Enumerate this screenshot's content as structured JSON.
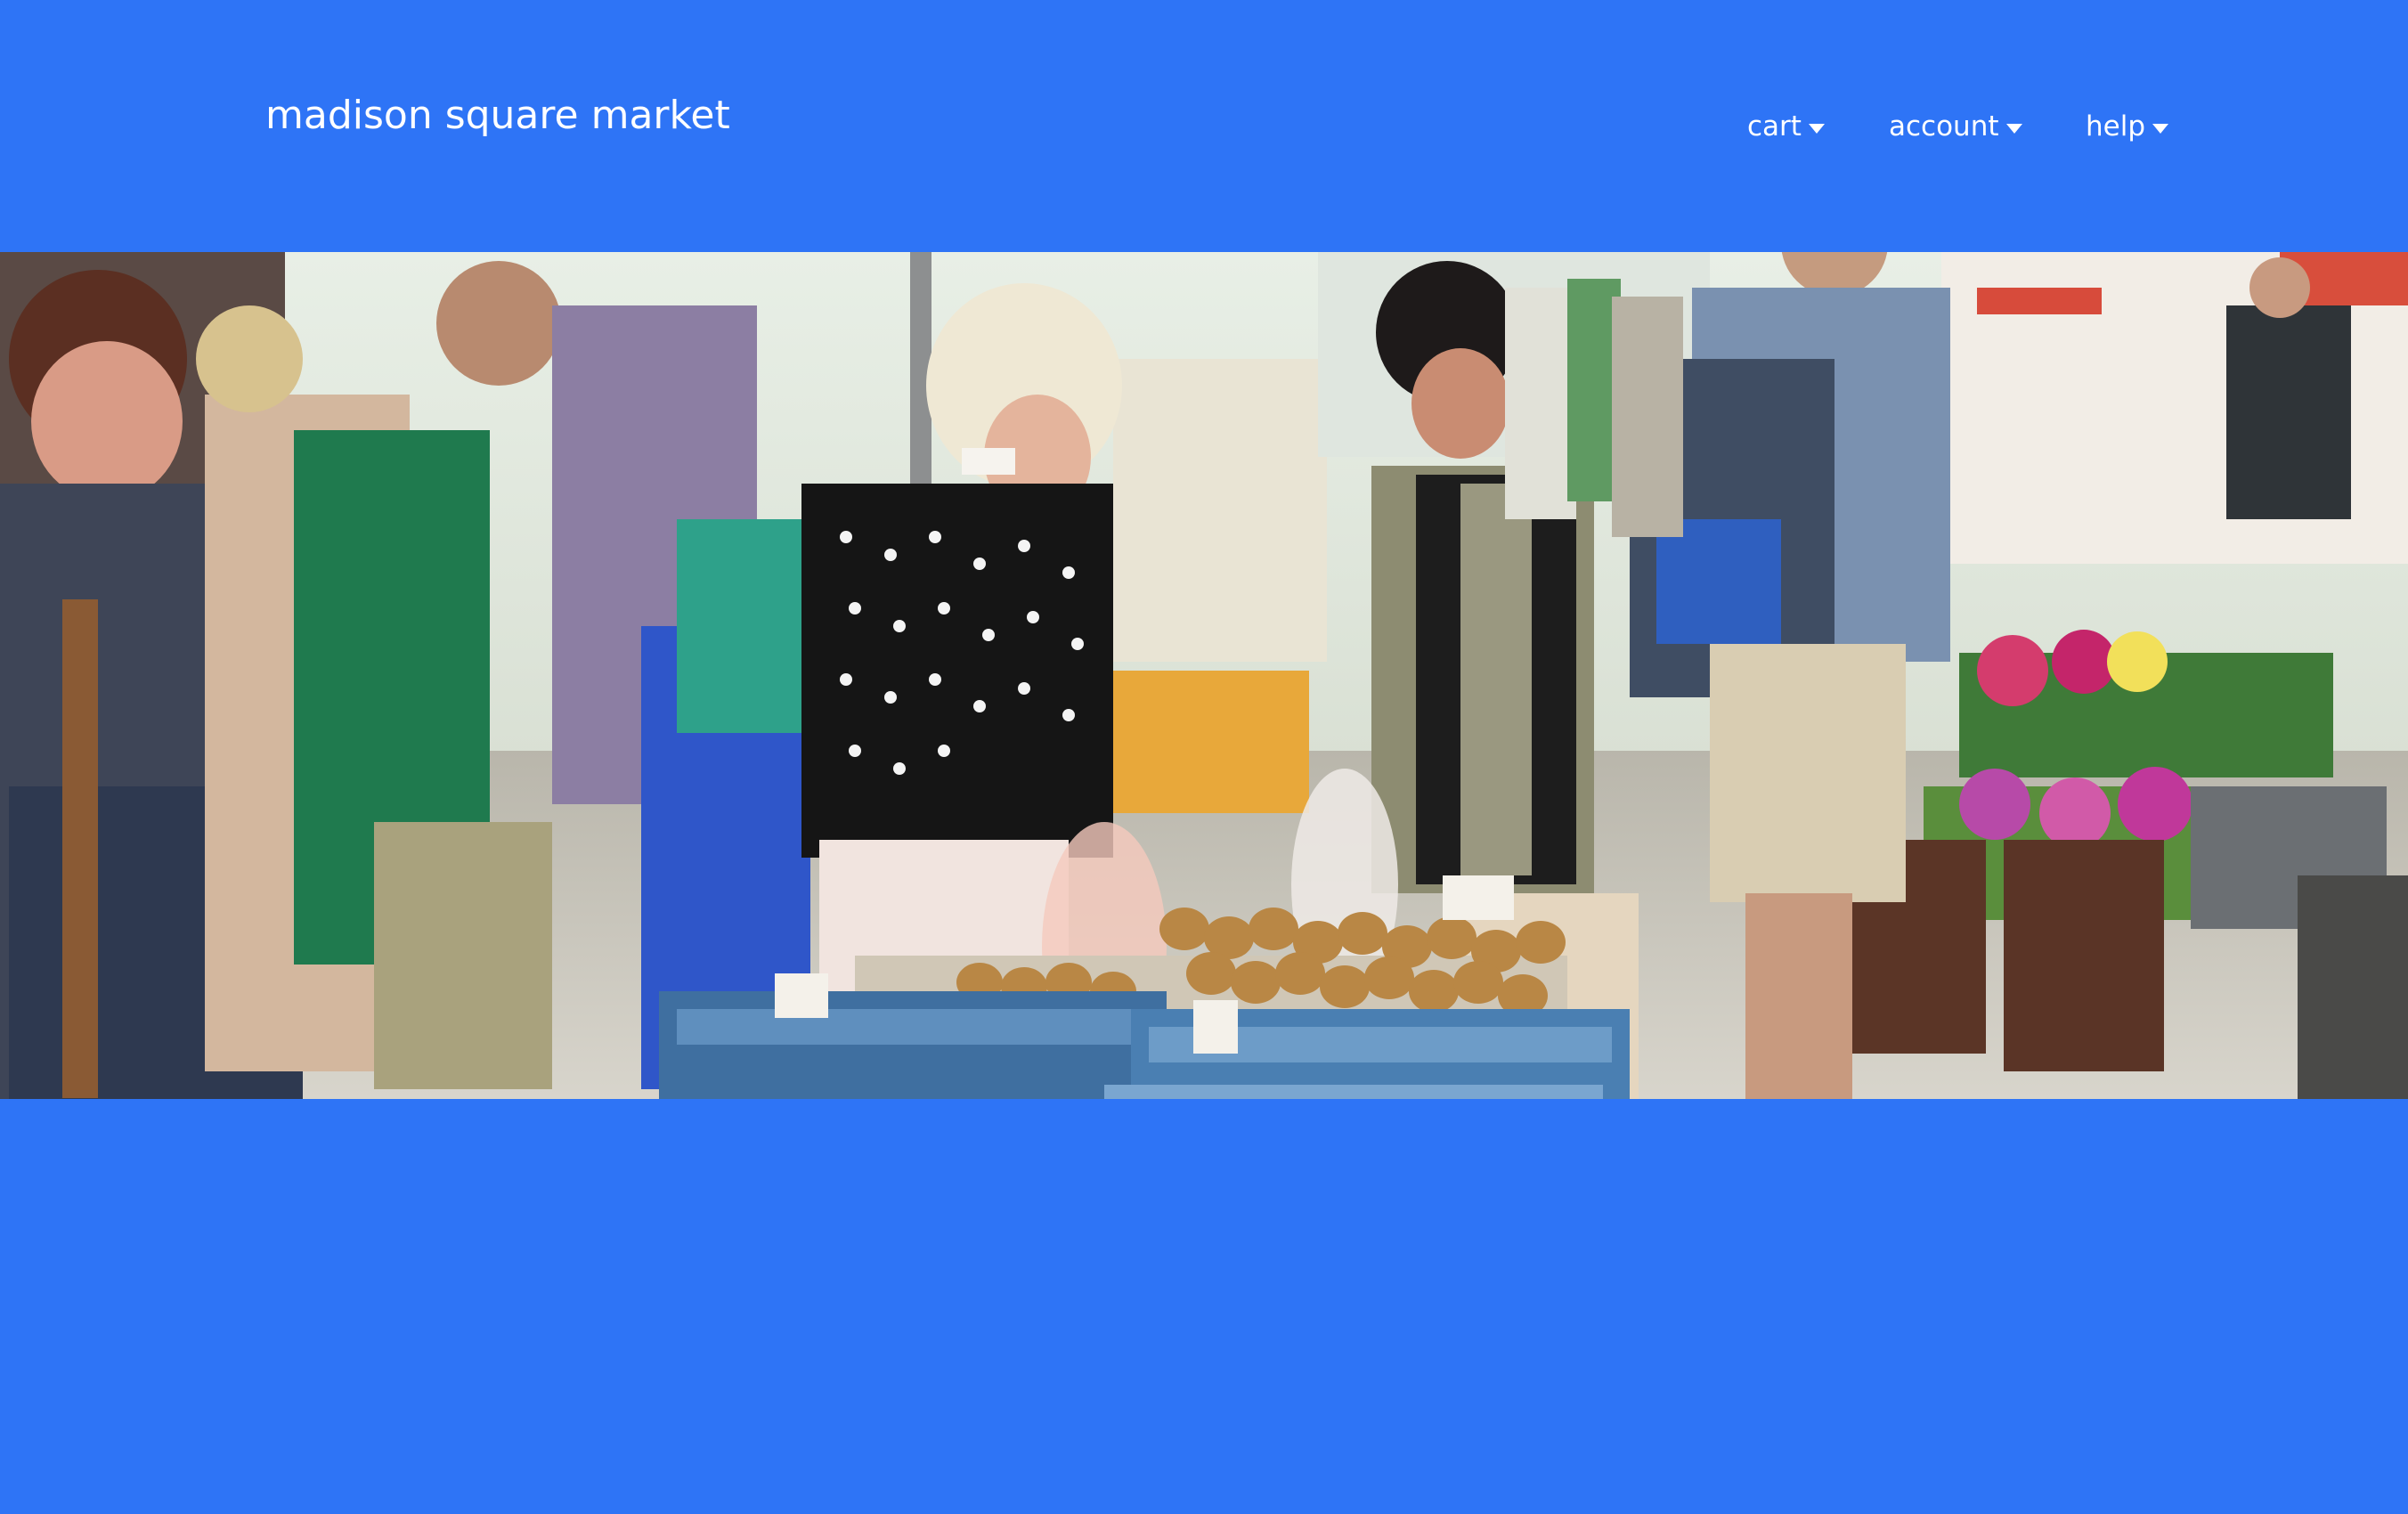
{
  "header": {
    "title": "madison square market",
    "background_color": "#2e74f6",
    "text_color": "#ffffff"
  },
  "nav": {
    "items": [
      {
        "label": "cart",
        "icon": "caret-down-icon"
      },
      {
        "label": "account",
        "icon": "caret-down-icon"
      },
      {
        "label": "help",
        "icon": "caret-down-icon"
      }
    ]
  },
  "hero": {
    "alt": "Shoppers browsing produce stalls at an outdoor farmers market"
  }
}
